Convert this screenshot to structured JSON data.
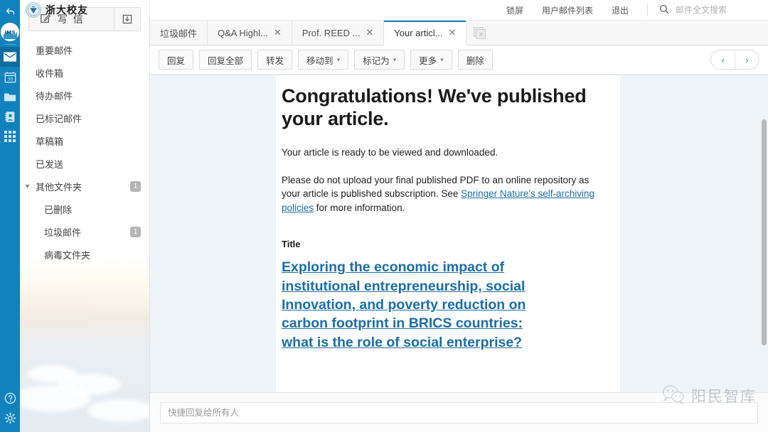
{
  "rail": {
    "items": [
      {
        "name": "back-icon",
        "label": "返回"
      },
      {
        "name": "app-logo-icon",
        "label": "IMS"
      },
      {
        "name": "mail-icon",
        "label": "邮件"
      },
      {
        "name": "calendar-icon",
        "label": "日历"
      },
      {
        "name": "folder-icon",
        "label": "文件"
      },
      {
        "name": "contacts-icon",
        "label": "通讯录"
      },
      {
        "name": "apps-grid-icon",
        "label": "应用"
      }
    ],
    "bottom": [
      {
        "name": "help-icon",
        "label": "帮助"
      },
      {
        "name": "settings-gear-icon",
        "label": "设置"
      }
    ],
    "calendar_day": "30"
  },
  "brand": {
    "text": "浙大校友"
  },
  "header": {
    "links": [
      "锁屏",
      "用户邮件列表",
      "退出"
    ],
    "search_placeholder": "邮件全文搜索",
    "search_value": ""
  },
  "sidebar": {
    "compose_label": "写 信",
    "receive_label": "收信",
    "folders": [
      {
        "label": "重要邮件",
        "sub": false,
        "badge": "",
        "caret": false
      },
      {
        "label": "收件箱",
        "sub": false,
        "badge": "",
        "caret": false
      },
      {
        "label": "待办邮件",
        "sub": false,
        "badge": "",
        "caret": false
      },
      {
        "label": "已标记邮件",
        "sub": false,
        "badge": "",
        "caret": false
      },
      {
        "label": "草稿箱",
        "sub": false,
        "badge": "",
        "caret": false
      },
      {
        "label": "已发送",
        "sub": false,
        "badge": "",
        "caret": false
      },
      {
        "label": "其他文件夹",
        "sub": false,
        "badge": "1",
        "caret": true
      },
      {
        "label": "已删除",
        "sub": true,
        "badge": "",
        "caret": false
      },
      {
        "label": "垃圾邮件",
        "sub": true,
        "badge": "1",
        "caret": false
      },
      {
        "label": "病毒文件夹",
        "sub": true,
        "badge": "",
        "caret": false
      }
    ]
  },
  "tabs": {
    "items": [
      {
        "label": "垃圾邮件",
        "closable": false,
        "active": false
      },
      {
        "label": "Q&A Highl...",
        "closable": true,
        "active": false
      },
      {
        "label": "Prof. REED ...",
        "closable": true,
        "active": false
      },
      {
        "label": "Your articl...",
        "closable": true,
        "active": true
      }
    ],
    "close_symbol": "✕",
    "close_all_name": "close-all-tabs"
  },
  "toolbar": {
    "buttons": [
      {
        "label": "回复",
        "caret": false
      },
      {
        "label": "回复全部",
        "caret": false
      },
      {
        "label": "转发",
        "caret": false
      },
      {
        "label": "移动到",
        "caret": true
      },
      {
        "label": "标记为",
        "caret": true
      },
      {
        "label": "更多",
        "caret": true
      },
      {
        "label": "删除",
        "caret": false
      }
    ],
    "prev_symbol": "‹",
    "next_symbol": "›"
  },
  "mail": {
    "heading": "Congratulations! We've published your article.",
    "para1": "Your article is ready to be viewed and downloaded.",
    "para2_before": "Please do not upload your final published PDF to an online repository as your article is published subscription. See ",
    "para2_link": "Springer Nature's self-archiving policies",
    "para2_after": " for more information.",
    "title_label": "Title",
    "title_link": "Exploring the economic impact of institutional entrepreneurship, social Innovation, and poverty reduction on carbon footprint in BRICS countries: what is the role of social enterprise?"
  },
  "reply": {
    "placeholder": "快捷回复给所有人",
    "value": ""
  },
  "watermark": {
    "text": "阳民智库"
  },
  "colors": {
    "rail_blue": "#1082bd",
    "rail_active": "#0a6ca0",
    "accent_blue": "#1b7bb9",
    "link_blue": "#1b6ea8",
    "page_gutter": "#edf4fa",
    "badge_grey": "#b5b5b5"
  }
}
